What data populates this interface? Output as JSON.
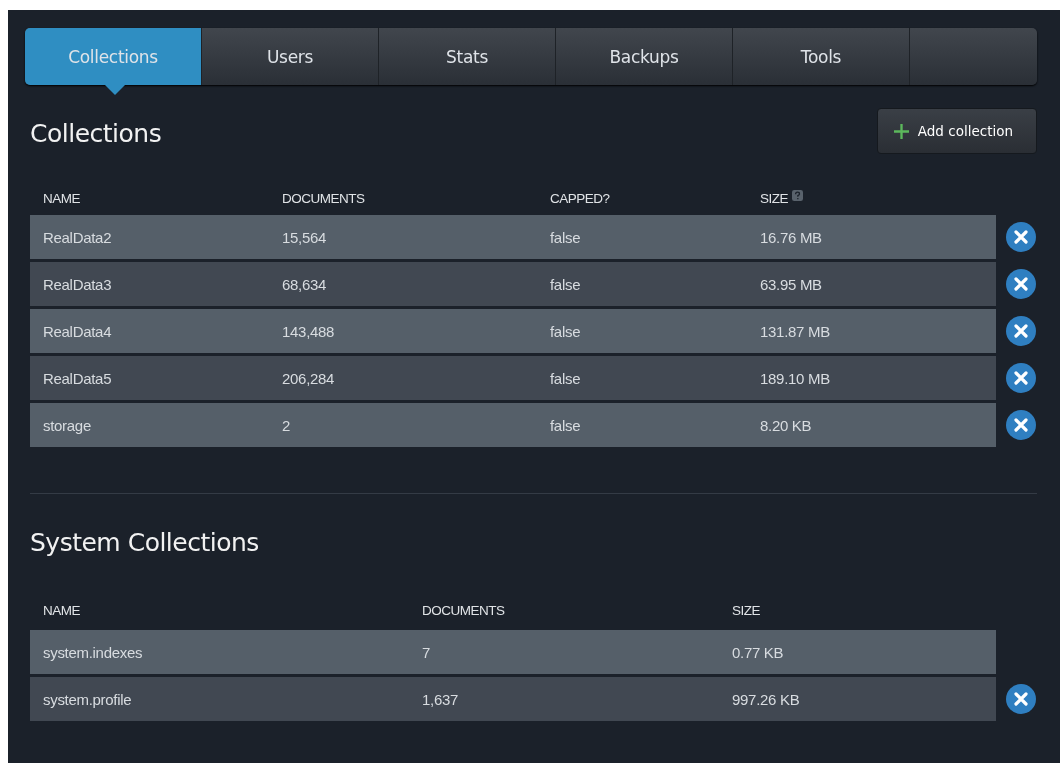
{
  "tabs": [
    {
      "label": "Collections",
      "selected": true
    },
    {
      "label": "Users",
      "selected": false
    },
    {
      "label": "Stats",
      "selected": false
    },
    {
      "label": "Backups",
      "selected": false
    },
    {
      "label": "Tools",
      "selected": false
    }
  ],
  "collections": {
    "title": "Collections",
    "add_button": "Add collection",
    "columns": [
      "NAME",
      "DOCUMENTS",
      "CAPPED?",
      "SIZE"
    ],
    "rows": [
      {
        "cells": [
          "RealData2",
          "15,564",
          "false",
          "16.76 MB"
        ],
        "deletable": true
      },
      {
        "cells": [
          "RealData3",
          "68,634",
          "false",
          "63.95 MB"
        ],
        "deletable": true
      },
      {
        "cells": [
          "RealData4",
          "143,488",
          "false",
          "131.87 MB"
        ],
        "deletable": true
      },
      {
        "cells": [
          "RealData5",
          "206,284",
          "false",
          "189.10 MB"
        ],
        "deletable": true
      },
      {
        "cells": [
          "storage",
          "2",
          "false",
          "8.20 KB"
        ],
        "deletable": true
      }
    ]
  },
  "system_collections": {
    "title": "System Collections",
    "columns": [
      "NAME",
      "DOCUMENTS",
      "SIZE"
    ],
    "rows": [
      {
        "cells": [
          "system.indexes",
          "7",
          "0.77 KB"
        ],
        "deletable": false
      },
      {
        "cells": [
          "system.profile",
          "1,637",
          "997.26 KB"
        ],
        "deletable": true
      }
    ]
  }
}
